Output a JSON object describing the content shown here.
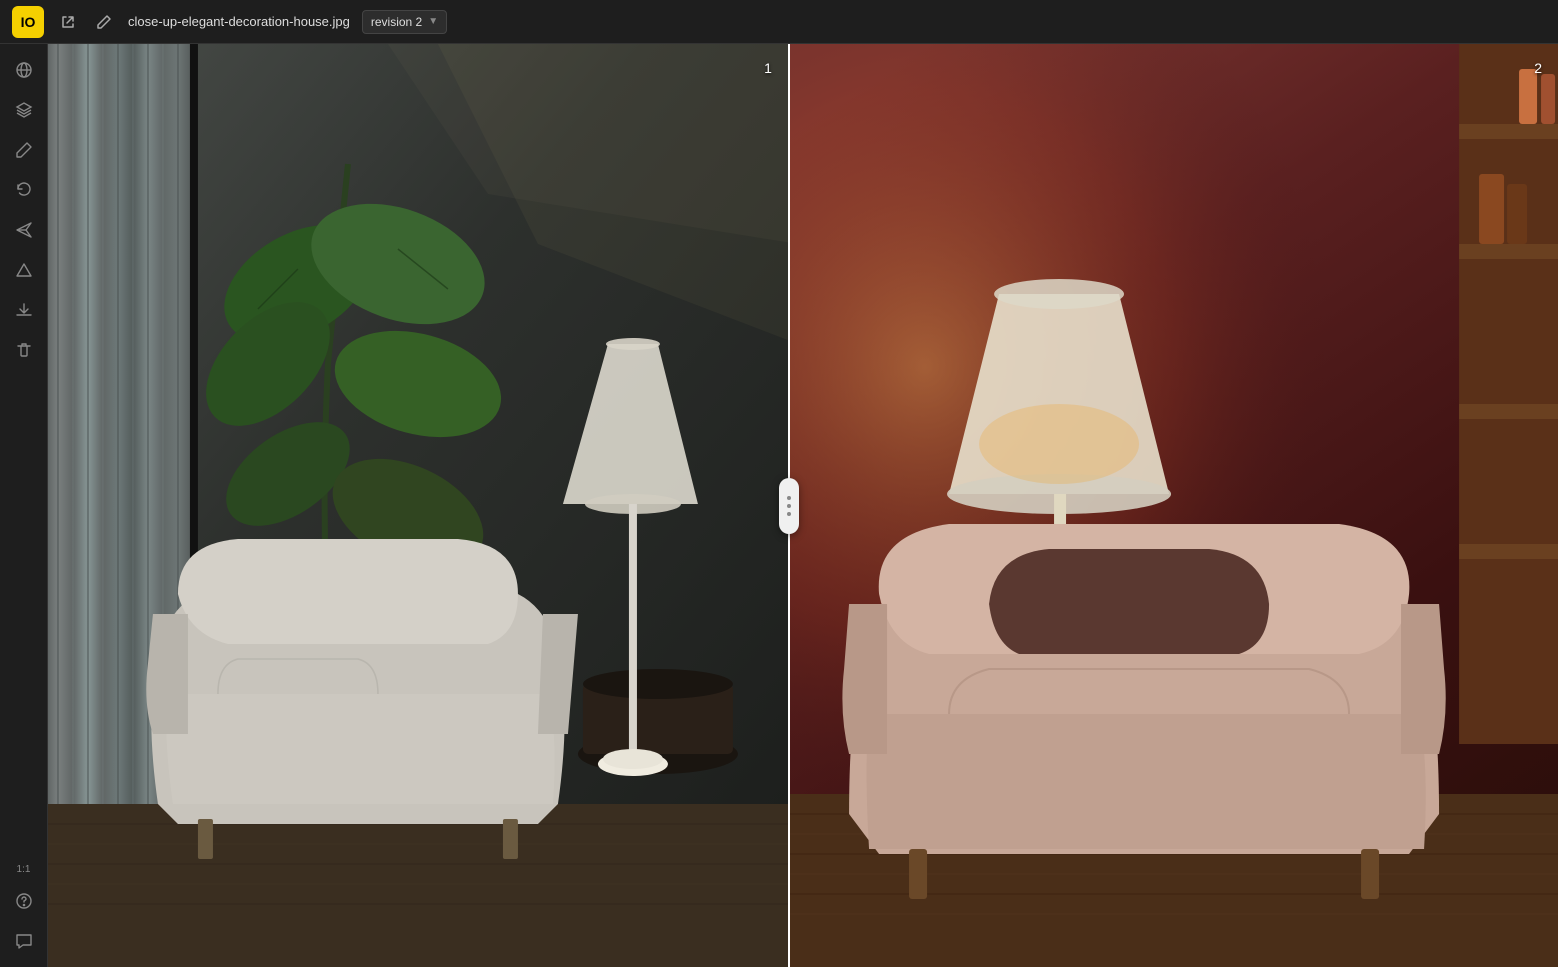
{
  "app": {
    "logo": "IO",
    "file_name": "close-up-elegant-decoration-house.jpg",
    "revision_label": "revision 2"
  },
  "topbar": {
    "external_link_icon": "⧉",
    "edit_icon": "✎"
  },
  "sidebar": {
    "items": [
      {
        "id": "globe",
        "icon": "🌐",
        "label": ""
      },
      {
        "id": "layers",
        "icon": "◫",
        "label": ""
      },
      {
        "id": "pen",
        "icon": "✏",
        "label": ""
      },
      {
        "id": "undo",
        "icon": "↩",
        "label": ""
      },
      {
        "id": "send",
        "icon": "➤",
        "label": ""
      },
      {
        "id": "triangle",
        "icon": "△",
        "label": ""
      },
      {
        "id": "download",
        "icon": "⬇",
        "label": ""
      },
      {
        "id": "trash",
        "icon": "🗑",
        "label": ""
      }
    ],
    "bottom_items": [
      {
        "id": "zoom",
        "label": "1:1"
      },
      {
        "id": "help",
        "icon": "?"
      },
      {
        "id": "chat",
        "icon": "💬"
      }
    ]
  },
  "comparison": {
    "left_panel_number": "1",
    "right_panel_number": "2",
    "divider_dots": 3
  }
}
